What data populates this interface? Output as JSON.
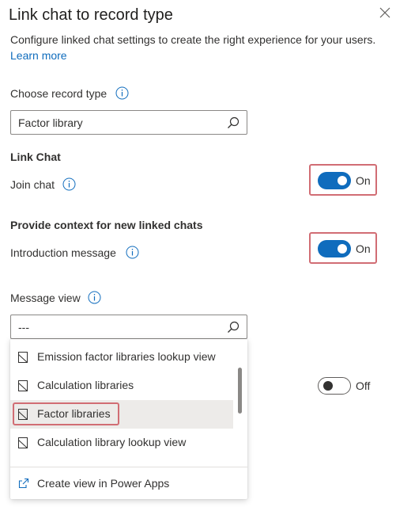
{
  "panel": {
    "title": "Link chat to record type",
    "description": "Configure linked chat settings to create the right experience for your users.",
    "learn_more": "Learn more"
  },
  "record_type": {
    "label": "Choose record type",
    "value": "Factor library"
  },
  "link_chat": {
    "heading": "Link Chat",
    "join_chat_label": "Join chat",
    "join_chat_state": "On"
  },
  "context": {
    "heading": "Provide context for new linked chats",
    "intro_label": "Introduction message",
    "intro_state": "On"
  },
  "message_view": {
    "label": "Message view",
    "value": "---",
    "hidden_toggle_state": "Off"
  },
  "dropdown": {
    "options": [
      {
        "label": "Emission factor libraries lookup view"
      },
      {
        "label": "Calculation libraries"
      },
      {
        "label": "Factor libraries"
      },
      {
        "label": "Calculation library lookup view"
      }
    ],
    "selected_index": 2,
    "footer_label": "Create view in Power Apps"
  },
  "colors": {
    "accent": "#0f6cbd",
    "highlight_border": "#d16d74",
    "selected_bg": "#edebe9"
  }
}
